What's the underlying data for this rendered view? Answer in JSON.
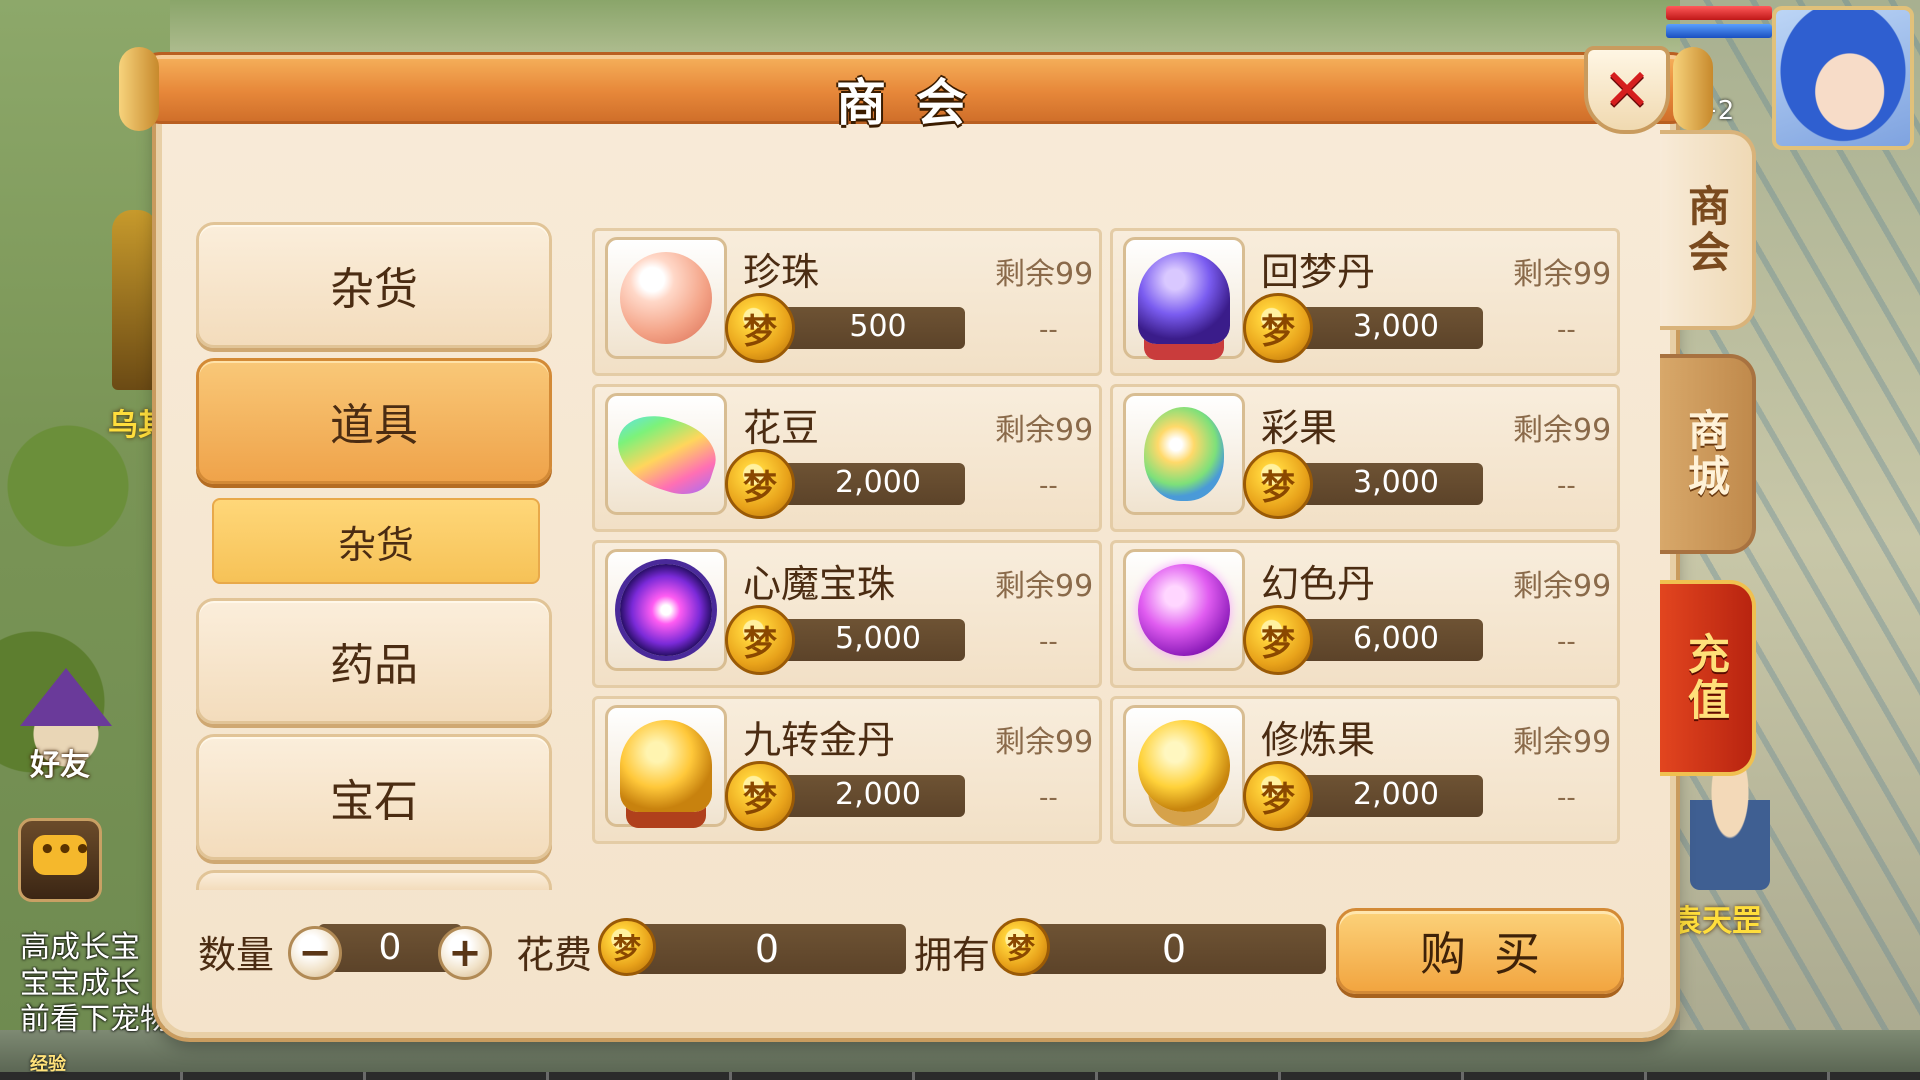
{
  "window": {
    "title": "商会",
    "close_icon": "close-icon"
  },
  "side_tabs": [
    {
      "label": "商会",
      "state": "active"
    },
    {
      "label": "商城",
      "state": "inactive"
    },
    {
      "label": "充值",
      "state": "highlight"
    }
  ],
  "categories": [
    {
      "label": "杂货",
      "state": "normal"
    },
    {
      "label": "道具",
      "state": "active"
    },
    {
      "label": "杂货",
      "state": "submenu-selected"
    },
    {
      "label": "药品",
      "state": "normal"
    },
    {
      "label": "宝石",
      "state": "normal"
    }
  ],
  "items": [
    {
      "name": "珍珠",
      "price": "500",
      "remaining": "剩余99",
      "limit": "--",
      "icon": "pearl-icon"
    },
    {
      "name": "回梦丹",
      "price": "3,000",
      "remaining": "剩余99",
      "limit": "--",
      "icon": "dream-pill-icon"
    },
    {
      "name": "花豆",
      "price": "2,000",
      "remaining": "剩余99",
      "limit": "--",
      "icon": "flower-bean-icon"
    },
    {
      "name": "彩果",
      "price": "3,000",
      "remaining": "剩余99",
      "limit": "--",
      "icon": "color-fruit-icon"
    },
    {
      "name": "心魔宝珠",
      "price": "5,000",
      "remaining": "剩余99",
      "limit": "--",
      "icon": "demon-orb-icon"
    },
    {
      "name": "幻色丹",
      "price": "6,000",
      "remaining": "剩余99",
      "limit": "--",
      "icon": "illusion-pill-icon"
    },
    {
      "name": "九转金丹",
      "price": "2,000",
      "remaining": "剩余99",
      "limit": "--",
      "icon": "golden-pill-icon"
    },
    {
      "name": "修炼果",
      "price": "2,000",
      "remaining": "剩余99",
      "limit": "--",
      "icon": "cultivation-fruit-icon"
    }
  ],
  "currency": {
    "coin_glyph": "梦",
    "icon": "dream-coin-icon"
  },
  "purchase": {
    "quantity_label": "数量",
    "quantity_value": "0",
    "minus_glyph": "−",
    "plus_glyph": "+",
    "cost_label": "花费",
    "cost_value": "0",
    "own_label": "拥有",
    "own_value": "0",
    "buy_label": "购买"
  },
  "background": {
    "npc_left_name": "乌其",
    "npc_right_name": "袁天罡",
    "friend_label": "好友",
    "chat_glyph": "•••",
    "messages": [
      "高成长宝",
      "宝宝成长",
      "前看下宠物"
    ],
    "level": "2",
    "exp_label": "经验"
  },
  "colors": {
    "title_orange": "#e7883a",
    "panel_cream": "#f8ebd8",
    "price_bar_brown": "#5c4329",
    "close_red": "#d51e1e",
    "recharge_red": "#c82e14"
  }
}
